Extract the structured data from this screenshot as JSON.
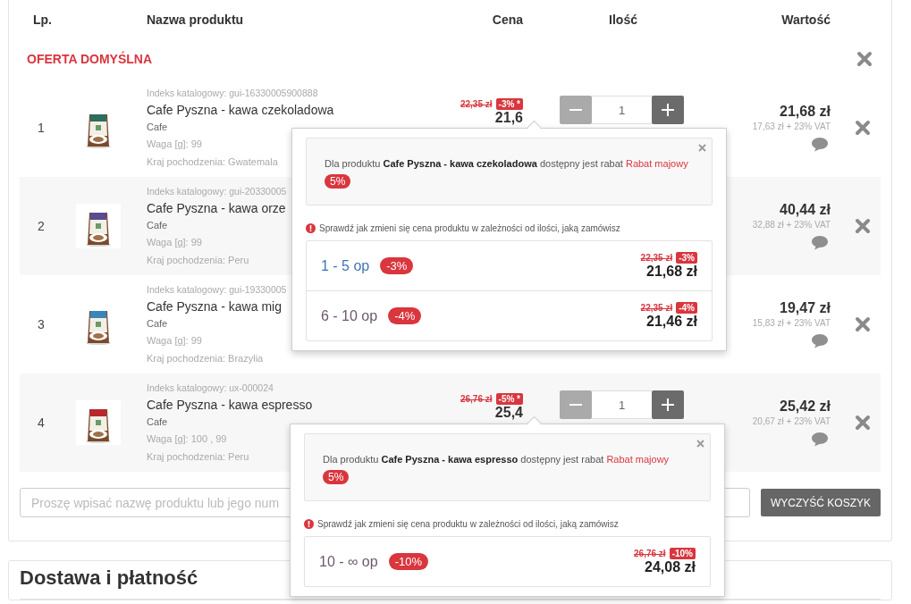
{
  "columns": [
    "Lp.",
    "Nazwa produktu",
    "Cena",
    "Ilość",
    "Wartość"
  ],
  "offer_title": "OFERTA DOMYŚLNA",
  "rows": [
    {
      "lp": "1",
      "index": "Indeks katalogowy: gui-16330005900888",
      "name": "Cafe Pyszna - kawa czekoladowa",
      "category": "Cafe",
      "weight": "Waga [g]: 99",
      "origin": "Kraj pochodzenia: Gwatemala",
      "price": {
        "old": "22,35 zł",
        "badge": "-3% *",
        "current": "21,6"
      },
      "quantity": "1",
      "value": "21,68 zł",
      "net": "17,63 zł + 23% VAT"
    },
    {
      "lp": "2",
      "index": "Indeks katalogowy: gui-20330005",
      "name": "Cafe Pyszna - kawa orze",
      "category": "Cafe",
      "weight": "Waga [g]: 99",
      "origin": "Kraj pochodzenia: Peru",
      "value": "40,44 zł",
      "net": "32,88 zł + 23% VAT"
    },
    {
      "lp": "3",
      "index": "Indeks katalogowy: gui-19330005",
      "name": "Cafe Pyszna - kawa mig",
      "category": "Cafe",
      "weight": "Waga [g]: 99",
      "origin": "Kraj pochodzenia: Brazylia",
      "value": "19,47 zł",
      "net": "15,83 zł + 23% VAT"
    },
    {
      "lp": "4",
      "index": "Indeks katalogowy: ux-000024",
      "name": "Cafe Pyszna - kawa espresso",
      "category": "Cafe",
      "weight": "Waga [g]: 100  , 99",
      "origin": "Kraj pochodzenia: Peru",
      "price": {
        "old": "26,76 zł",
        "badge": "-5% *",
        "current": "25,4"
      },
      "quantity": "1",
      "value": "25,42 zł",
      "net": "20,67 zł + 23% VAT"
    }
  ],
  "search": {
    "placeholder": "Proszę wpisać nazwę produktu lub jego num"
  },
  "clear_button": "WYCZYŚĆ KOSZYK",
  "delivery": {
    "title": "Dostawa i płatność"
  },
  "popovers": [
    {
      "text": "Dla produktu **Cafe Pyszna - kawa czekoladowa** dostępny jest rabat",
      "discount_name": "Rabat majowy",
      "discount_badge": "5%",
      "hint": "Sprawdź jak zmieni się cena produktu w zależności od ilości, jaką zamówisz",
      "tiers": [
        {
          "range": "1 - 5 op",
          "badge": "-3%",
          "old_price": "22,35 zł",
          "old_badge": "-3%",
          "price": "21,68 zł",
          "selected": true
        },
        {
          "range": "6 - 10 op",
          "badge": "-4%",
          "old_price": "22,35 zł",
          "old_badge": "-4%",
          "price": "21,46 zł",
          "selected": false
        }
      ]
    },
    {
      "text": "Dla produktu **Cafe Pyszna - kawa espresso** dostępny jest rabat",
      "discount_name": "Rabat majowy",
      "discount_badge": "5%",
      "hint": "Sprawdź jak zmieni się cena produktu w zależności od ilości, jaką zamówisz",
      "tiers": [
        {
          "range": "10 - ∞ op",
          "badge": "-10%",
          "old_price": "26,76 zł",
          "old_badge": "-10%",
          "price": "24,08 zł",
          "selected": false
        }
      ]
    }
  ]
}
